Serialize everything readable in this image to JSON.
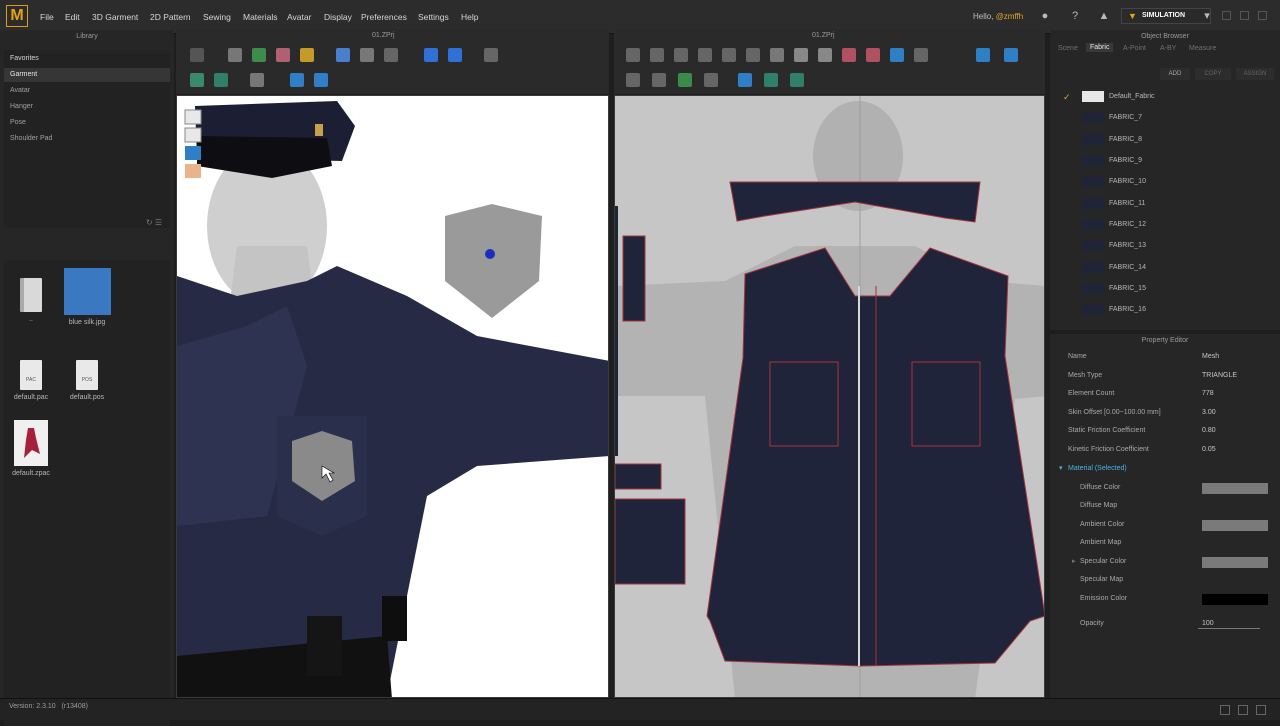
{
  "menu": {
    "logo": "M",
    "items": [
      "File",
      "Edit",
      "3D Garment",
      "2D Pattern",
      "Sewing",
      "Materials",
      "Avatar",
      "Display",
      "Preferences",
      "Settings",
      "Help"
    ],
    "greeting": "Hello,",
    "username": "@zmffh",
    "mode_button": "SIMULATION"
  },
  "library": {
    "title": "Library",
    "tree": [
      "Favorites",
      "Garment",
      "Avatar",
      "Hanger",
      "Pose",
      "Shoulder Pad"
    ],
    "selected": "Garment",
    "files": [
      {
        "name": "..",
        "type": "folder"
      },
      {
        "name": "blue silk.jpg",
        "type": "image"
      },
      {
        "name": "default.pac",
        "type": "PAC"
      },
      {
        "name": "default.pos",
        "type": "POS"
      },
      {
        "name": "default.zpac",
        "type": "zpac"
      }
    ]
  },
  "viewport3d": {
    "title": "01.ZPrj"
  },
  "viewport2d": {
    "title": "01.ZPrj"
  },
  "object_browser": {
    "title": "Object Browser",
    "tabs": [
      "Scene",
      "Fabric",
      "A-Point",
      "A-BY",
      "Measure"
    ],
    "active_tab": "Fabric",
    "actions": [
      "ADD",
      "COPY",
      "ASSIGN"
    ],
    "fabrics": [
      "Default_Fabric",
      "FABRIC_7",
      "FABRIC_8",
      "FABRIC_9",
      "FABRIC_10",
      "FABRIC_11",
      "FABRIC_12",
      "FABRIC_13",
      "FABRIC_14",
      "FABRIC_15",
      "FABRIC_16"
    ],
    "colors": {
      "default_swatch": "#e6e6e6",
      "fabric_swatch": "#1f2436",
      "check": "#e0a628"
    }
  },
  "property_editor": {
    "title": "Property Editor",
    "rows": [
      {
        "label": "Name",
        "value": "Mesh"
      },
      {
        "label": "Mesh Type",
        "value": "TRIANGLE"
      },
      {
        "label": "Element Count",
        "value": "778"
      },
      {
        "label": "Skin Offset [0.00~100.00 mm]",
        "value": "3.00"
      },
      {
        "label": "Static Friction Coefficient",
        "value": "0.80"
      },
      {
        "label": "Kinetic Friction Coefficient",
        "value": "0.05"
      }
    ],
    "material_section": "Material (Selected)",
    "material_rows": [
      {
        "label": "Diffuse Color",
        "color": "#7a7a7a"
      },
      {
        "label": "Diffuse Map"
      },
      {
        "label": "Ambient Color",
        "color": "#7a7a7a"
      },
      {
        "label": "Ambient Map"
      },
      {
        "label": "Specular Color",
        "color": "#7a7a7a"
      },
      {
        "label": "Specular Map"
      },
      {
        "label": "Emission Color",
        "color": "#000000"
      }
    ],
    "opacity_label": "Opacity",
    "opacity_value": "100",
    "colors": {
      "section_link": "#4fb0e6"
    }
  },
  "status": {
    "version": "Version: 2.3.10",
    "build": "(r13408)"
  },
  "colors": {
    "shirt": "#23273d",
    "accent": "#e0a628",
    "stitch": "#a8323a"
  }
}
